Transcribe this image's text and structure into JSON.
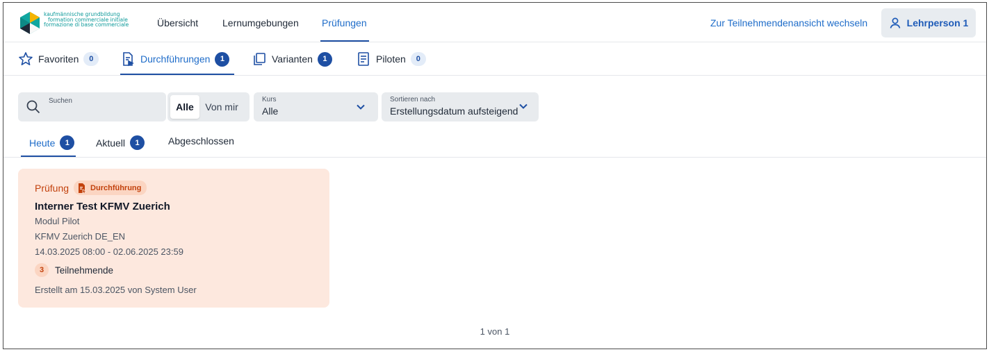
{
  "brand": {
    "line1": "kaufmännische grundbildung",
    "line2": "formation commerciale initiale",
    "line3": "formazione di base commerciale"
  },
  "nav": {
    "items": [
      {
        "label": "Übersicht"
      },
      {
        "label": "Lernumgebungen"
      },
      {
        "label": "Prüfungen"
      }
    ],
    "active": "Prüfungen",
    "switch_view": "Zur Teilnehmendenansicht wechseln",
    "user": "Lehrperson 1"
  },
  "subtabs": [
    {
      "label": "Favoriten",
      "count": "0"
    },
    {
      "label": "Durchführungen",
      "count": "1"
    },
    {
      "label": "Varianten",
      "count": "1"
    },
    {
      "label": "Piloten",
      "count": "0"
    }
  ],
  "filters": {
    "search_placeholder": "Suchen",
    "owner_options": [
      "Alle",
      "Von mir"
    ],
    "owner_selected": "Alle",
    "course_label": "Kurs",
    "course_value": "Alle",
    "sort_label": "Sortieren nach",
    "sort_value": "Erstellungsdatum aufsteigend"
  },
  "status_tabs": [
    {
      "label": "Heute",
      "count": "1"
    },
    {
      "label": "Aktuell",
      "count": "1"
    },
    {
      "label": "Abgeschlossen"
    }
  ],
  "cards": [
    {
      "type": "Prüfung",
      "kind": "Durchführung",
      "title": "Interner Test KFMV Zuerich",
      "module": "Modul Pilot",
      "group": "KFMV Zuerich DE_EN",
      "period": "14.03.2025 08:00 - 02.06.2025 23:59",
      "participants": "3",
      "participants_label": "Teilnehmende",
      "created": "Erstellt am 15.03.2025 von System User"
    }
  ],
  "pagination": "1 von 1",
  "colors": {
    "accent": "#1e4fa3",
    "link": "#1e6cc9",
    "card_bg": "#fde8de",
    "card_accent": "#c2410c"
  }
}
